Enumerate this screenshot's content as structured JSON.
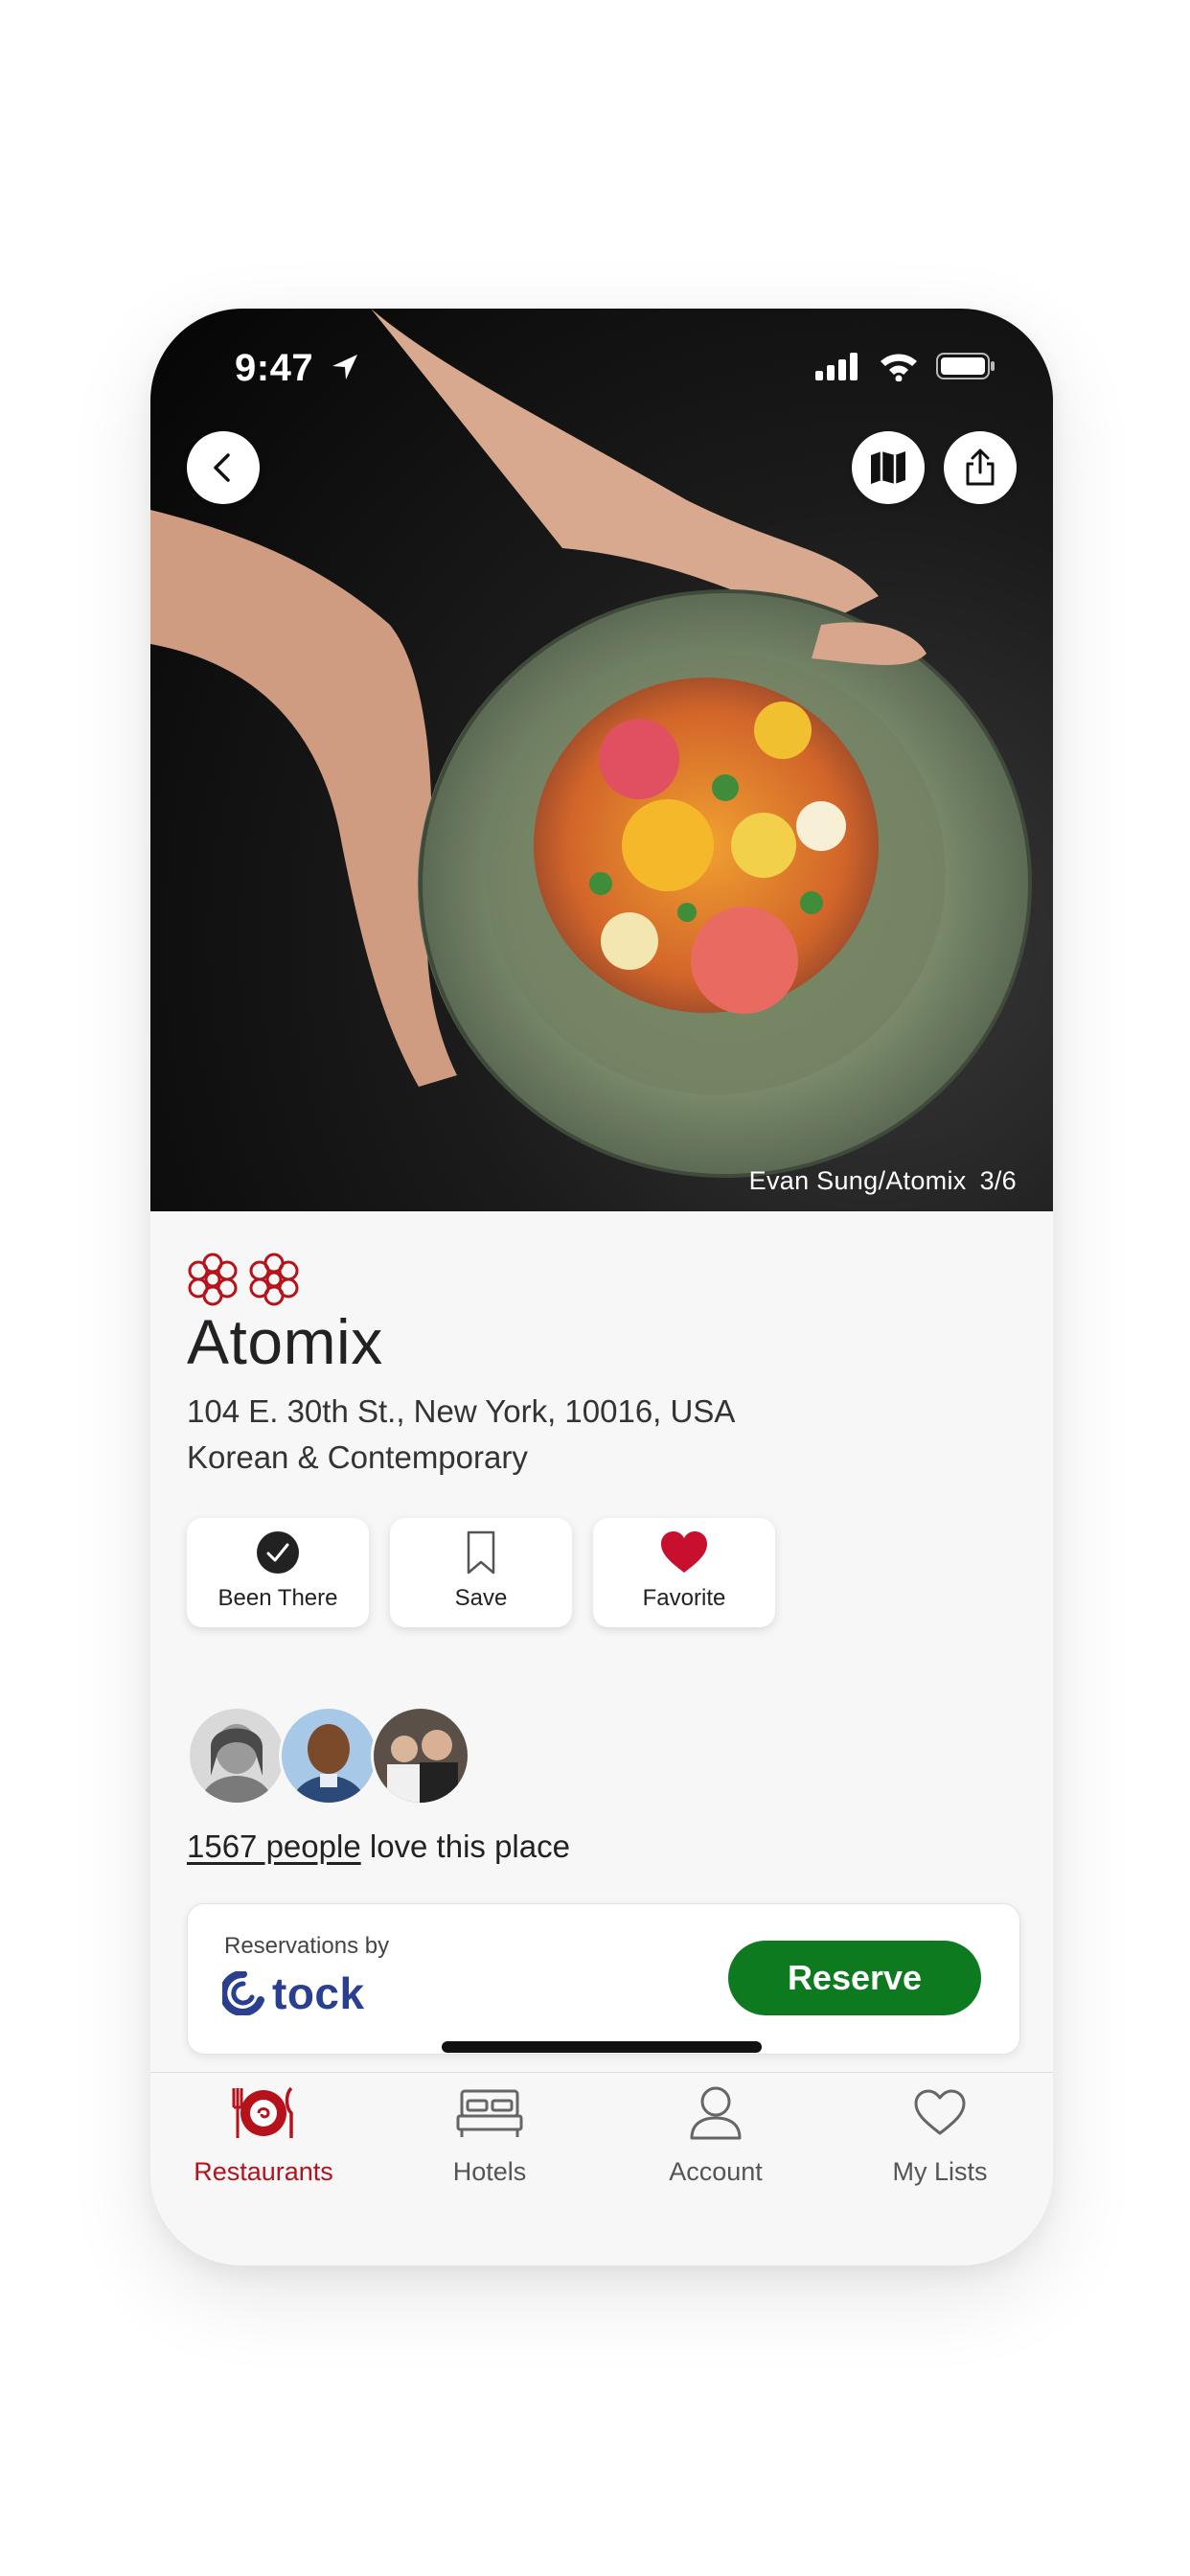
{
  "status_bar": {
    "time": "9:47"
  },
  "hero": {
    "photo_credit": "Evan Sung/Atomix",
    "photo_index": "3/6",
    "back_icon": "chevron-left-icon",
    "map_icon": "map-icon",
    "share_icon": "share-icon"
  },
  "restaurant": {
    "stars_count": 2,
    "name": "Atomix",
    "address": "104 E. 30th St., New York, 10016, USA",
    "cuisine": "Korean & Contemporary"
  },
  "actions": {
    "been_there": "Been There",
    "save": "Save",
    "favorite": "Favorite"
  },
  "community": {
    "count_text": "1567 people",
    "suffix": " love this place"
  },
  "reservation": {
    "label": "Reservations by",
    "provider": "tock",
    "button": "Reserve"
  },
  "tabbar": {
    "items": [
      {
        "label": "Restaurants",
        "icon": "plate-icon",
        "active": true
      },
      {
        "label": "Hotels",
        "icon": "bed-icon",
        "active": false
      },
      {
        "label": "Account",
        "icon": "person-icon",
        "active": false
      },
      {
        "label": "My Lists",
        "icon": "heart-outline-icon",
        "active": false
      }
    ]
  },
  "colors": {
    "michelin_red": "#b5121b",
    "reserve_green": "#0e7a1f",
    "tock_blue": "#2a3f8f",
    "background": "#f7f7f7"
  }
}
